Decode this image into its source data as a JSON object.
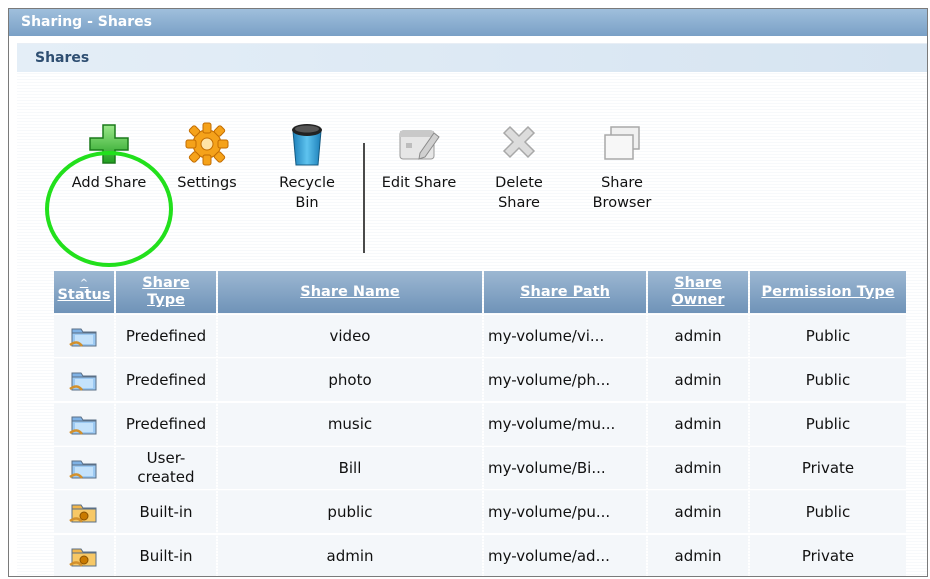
{
  "window": {
    "title": "Sharing - Shares"
  },
  "section": {
    "title": "Shares"
  },
  "toolbar": {
    "add_share": "Add Share",
    "settings": "Settings",
    "recycle_bin_1": "Recycle",
    "recycle_bin_2": "Bin",
    "edit_share": "Edit Share",
    "delete_share_1": "Delete",
    "delete_share_2": "Share",
    "share_browser_1": "Share",
    "share_browser_2": "Browser"
  },
  "table": {
    "headers": {
      "status": "Status",
      "share_type_1": "Share",
      "share_type_2": "Type",
      "share_name": "Share Name",
      "share_path": "Share Path",
      "share_owner_1": "Share",
      "share_owner_2": "Owner",
      "permission_type": "Permission Type"
    },
    "rows": [
      {
        "status_icon": "shared-folder-icon",
        "type_1": "Predefined",
        "type_2": "",
        "name": "video",
        "path": "my-volume/vi...",
        "owner": "admin",
        "permission": "Public"
      },
      {
        "status_icon": "shared-folder-icon",
        "type_1": "Predefined",
        "type_2": "",
        "name": "photo",
        "path": "my-volume/ph...",
        "owner": "admin",
        "permission": "Public"
      },
      {
        "status_icon": "shared-folder-icon",
        "type_1": "Predefined",
        "type_2": "",
        "name": "music",
        "path": "my-volume/mu...",
        "owner": "admin",
        "permission": "Public"
      },
      {
        "status_icon": "shared-folder-icon",
        "type_1": "User-",
        "type_2": "created",
        "name": "Bill",
        "path": "my-volume/Bi...",
        "owner": "admin",
        "permission": "Private"
      },
      {
        "status_icon": "builtin-folder-icon",
        "type_1": "Built-in",
        "type_2": "",
        "name": "public",
        "path": "my-volume/pu...",
        "owner": "admin",
        "permission": "Public"
      },
      {
        "status_icon": "builtin-folder-icon",
        "type_1": "Built-in",
        "type_2": "",
        "name": "admin",
        "path": "my-volume/ad...",
        "owner": "admin",
        "permission": "Private"
      }
    ]
  },
  "colors": {
    "titlebar": "#7aa0c6",
    "header": "#6f93b8",
    "highlight": "#22e01c"
  }
}
